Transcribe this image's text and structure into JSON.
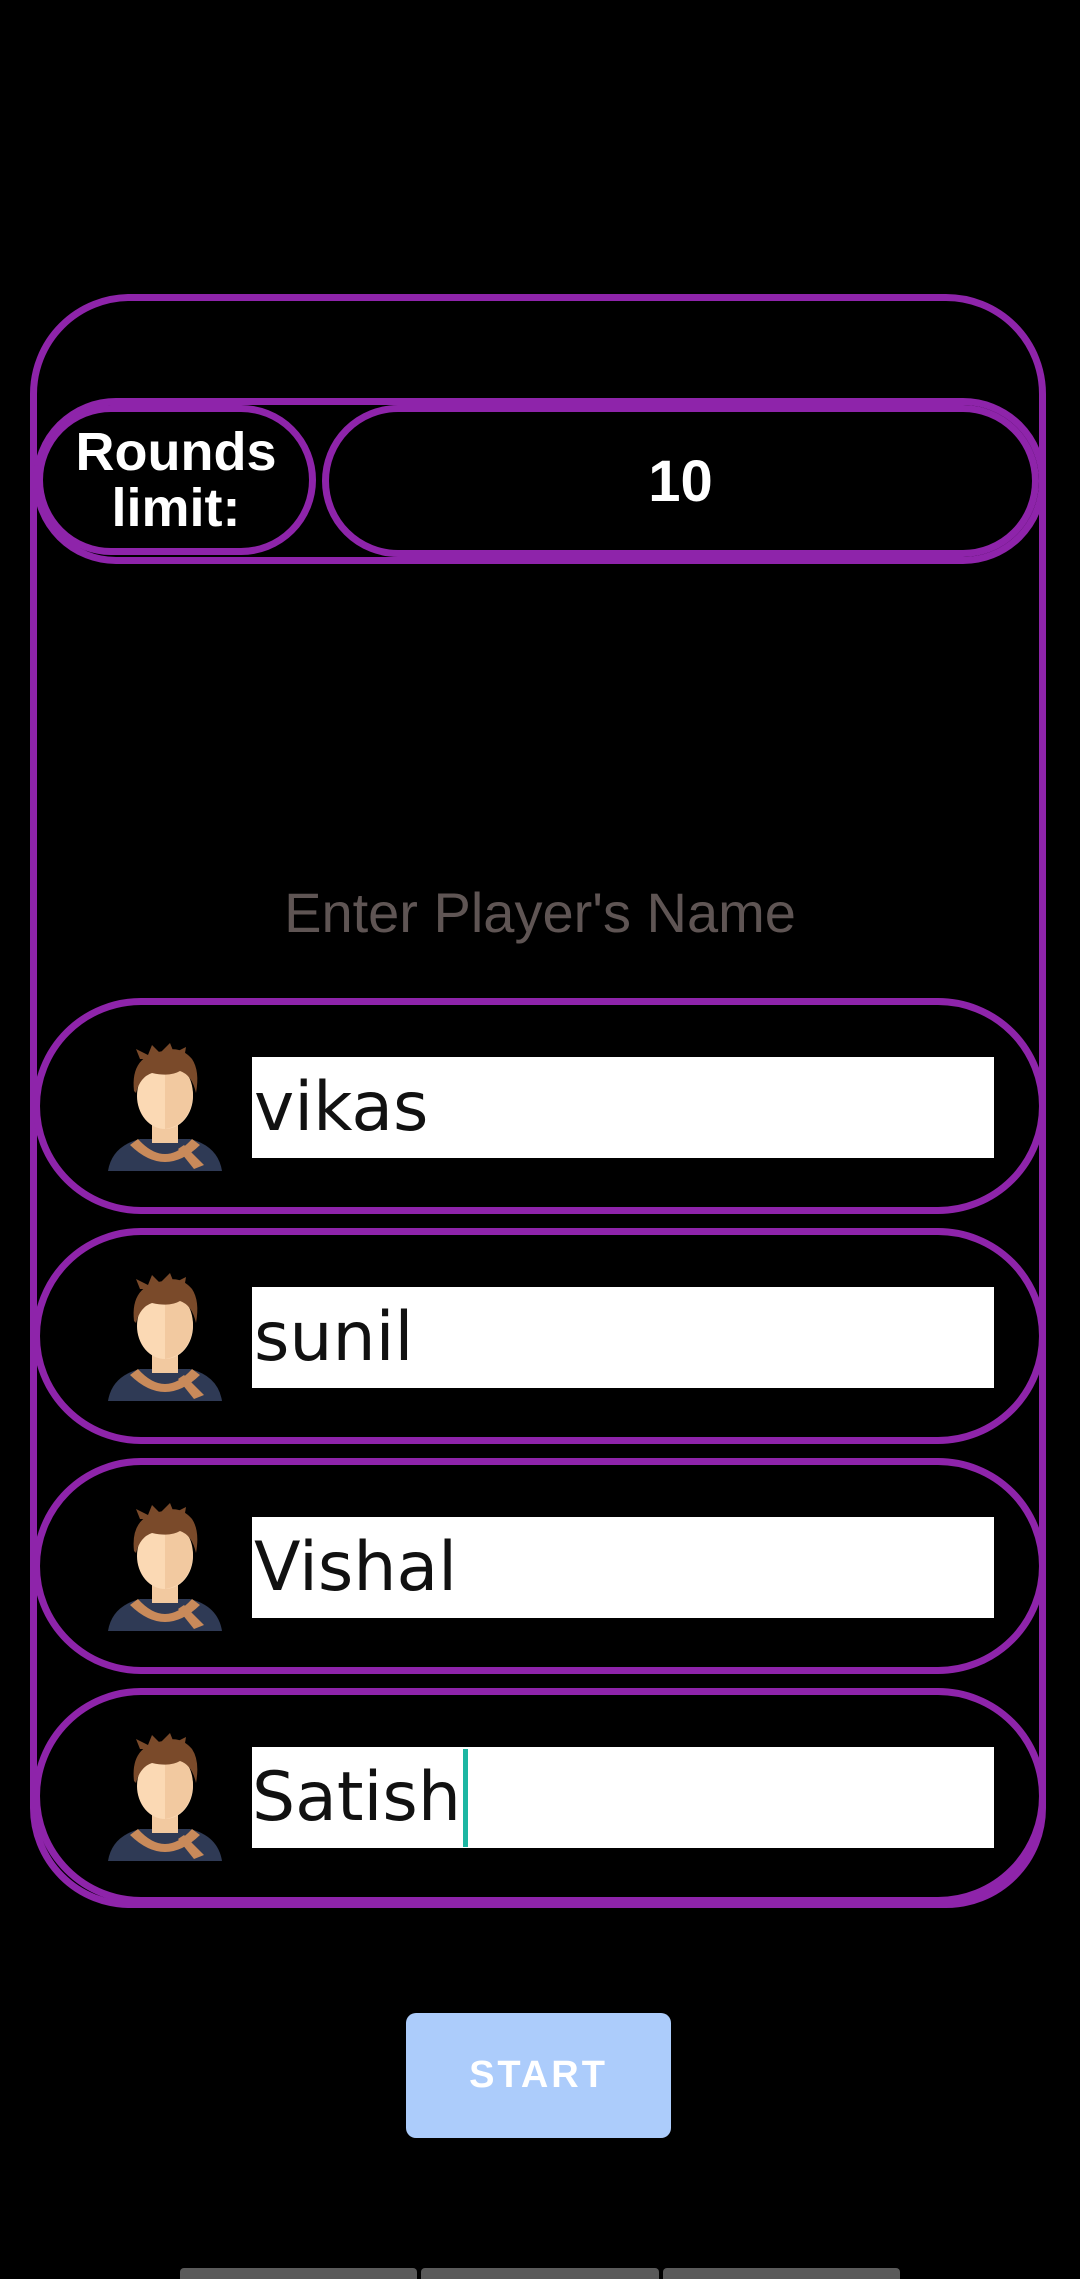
{
  "rounds": {
    "label": "Rounds\nlimit:",
    "value": "10"
  },
  "hint": "Enter Player's Name",
  "players": [
    {
      "name": "vikas",
      "avatar_icon": "player-avatar-icon"
    },
    {
      "name": "sunil",
      "avatar_icon": "player-avatar-icon"
    },
    {
      "name": "Vishal",
      "avatar_icon": "player-avatar-icon"
    },
    {
      "name": "Satish",
      "avatar_icon": "player-avatar-icon",
      "focused": true
    }
  ],
  "start_label": "START",
  "colors": {
    "accent": "#8e24aa",
    "background": "#000000",
    "start_button": "#acccfb",
    "hint_text": "#5f5554",
    "cursor": "#1db6a2"
  }
}
